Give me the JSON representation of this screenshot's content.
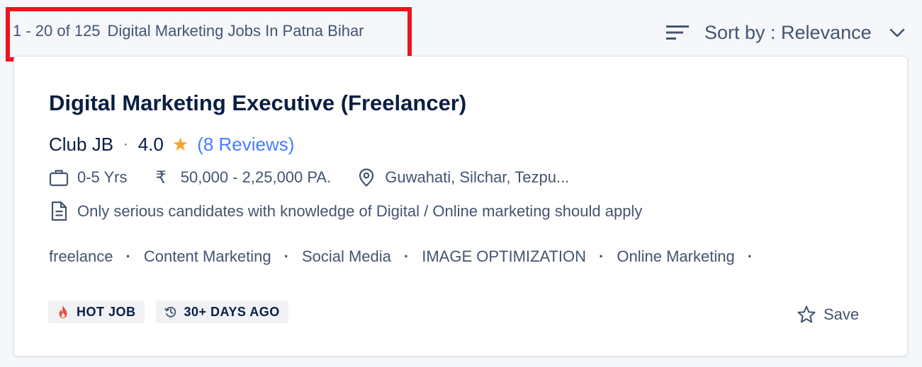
{
  "results_header": {
    "count": "1 - 20 of 125",
    "query": "Digital Marketing Jobs In Patna Bihar"
  },
  "sort": {
    "icon": "sort-lines-icon",
    "label": "Sort by : Relevance",
    "chevron_icon": "chevron-down-icon"
  },
  "job": {
    "title": "Digital Marketing Executive (Freelancer)",
    "company": "Club JB",
    "rating": "4.0",
    "reviews": "(8 Reviews)",
    "star_color": "#f5a623",
    "experience": "0-5 Yrs",
    "salary": "50,000 - 2,25,000 PA.",
    "rupee_symbol": "₹",
    "location": "Guwahati, Silchar, Tezpu...",
    "description": "Only serious candidates with knowledge of Digital / Online marketing should apply",
    "tags": [
      "freelance",
      "Content Marketing",
      "Social Media",
      "IMAGE OPTIMIZATION",
      "Online Marketing"
    ],
    "badges": {
      "hot": "HOT JOB",
      "age": "30+ DAYS AGO"
    },
    "save_label": "Save"
  },
  "colors": {
    "highlight": "#f0131e",
    "link": "#457eff",
    "text_primary": "#091e42",
    "text_secondary": "#44546f"
  }
}
